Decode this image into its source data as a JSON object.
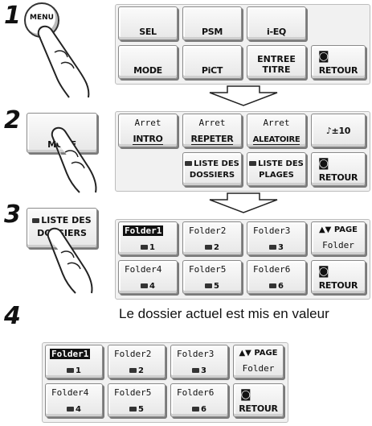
{
  "steps": {
    "s1": "1",
    "s2": "2",
    "s3": "3",
    "s4": "4"
  },
  "menu_key": "MENU",
  "panel1": {
    "sel": "SEL",
    "psm": "PSM",
    "ieq": "i-EQ",
    "mode": "MODE",
    "pict": "PiCT",
    "entree_line1": "ENTREE",
    "entree_line2": "TITRE",
    "retour": "RETOUR"
  },
  "step2_button": "MODE",
  "panel2": {
    "intro_top": "Arret",
    "intro": "INTRO",
    "repeter_top": "Arret",
    "repeter": "REPETER",
    "aleatoire_top": "Arret",
    "aleatoire": "ALEATOIRE",
    "skip": "♪±10",
    "liste_dossiers_1": "LISTE DES",
    "liste_dossiers_2": "DOSSIERS",
    "liste_plages_1": "LISTE DES",
    "liste_plages_2": "PLAGES",
    "retour": "RETOUR"
  },
  "step3_button": {
    "line1": "LISTE DES",
    "line2": "DOSSIERS"
  },
  "folders": [
    {
      "name": "Folder1",
      "num": "1"
    },
    {
      "name": "Folder2",
      "num": "2"
    },
    {
      "name": "Folder3",
      "num": "3"
    },
    {
      "name": "Folder4",
      "num": "4"
    },
    {
      "name": "Folder5",
      "num": "5"
    },
    {
      "name": "Folder6",
      "num": "6"
    }
  ],
  "page_label": "PAGE",
  "page_sub": "Folder",
  "retour": "RETOUR",
  "caption": "Le dossier actuel est mis en valeur"
}
